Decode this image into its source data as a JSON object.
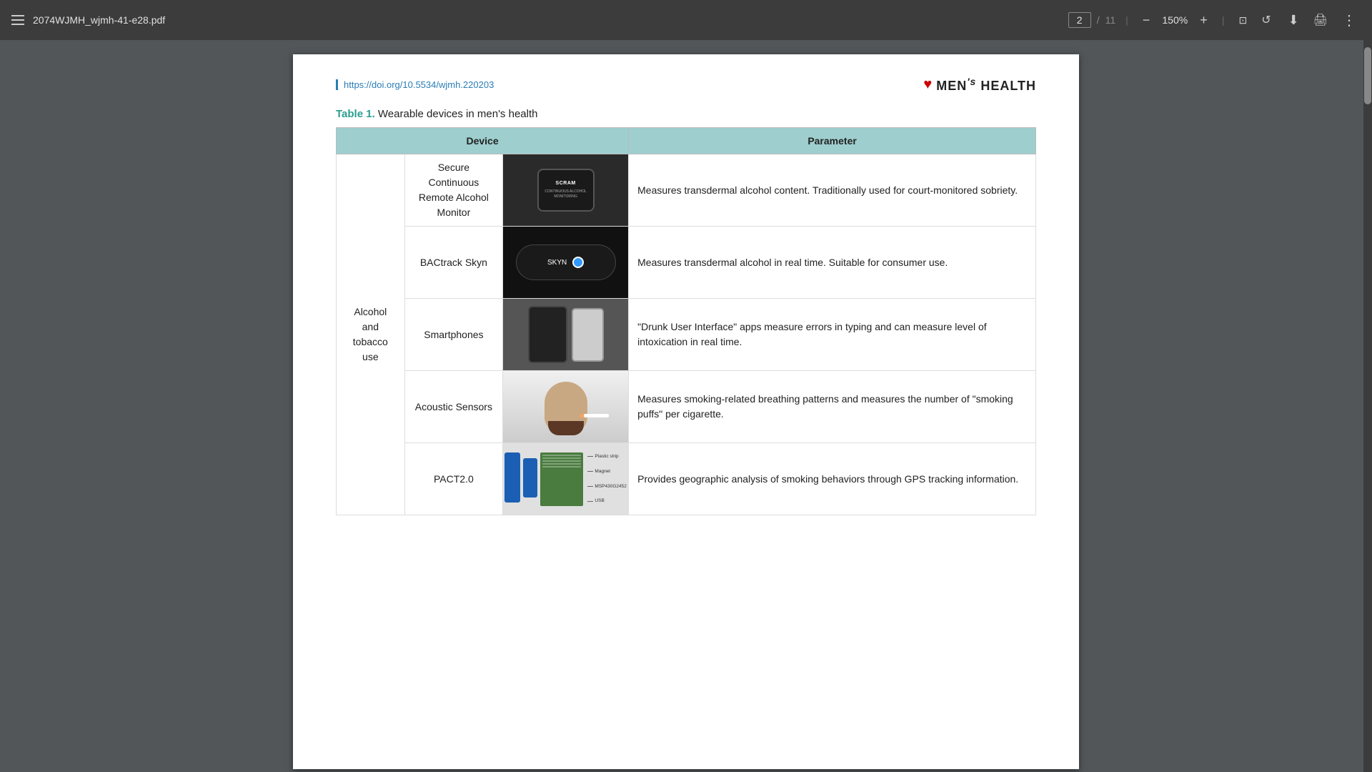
{
  "toolbar": {
    "filename": "2074WJMH_wjmh-41-e28.pdf",
    "hamburger_label": "menu",
    "current_page": "2",
    "total_pages": "11",
    "zoom": "150%",
    "download_label": "download",
    "print_label": "print",
    "more_label": "more",
    "zoom_in_label": "+",
    "zoom_out_label": "−",
    "fit_page_label": "fit page",
    "history_label": "history"
  },
  "page": {
    "doi": "https://doi.org/10.5534/wjmh.220203",
    "journal_name": "MEN's HEALTH",
    "table_label": "Table 1.",
    "table_title": "Wearable devices in men's health",
    "columns": {
      "device_header": "Device",
      "param_header": "Parameter"
    },
    "rows": [
      {
        "category": "Alcohol and tobacco use",
        "device_name": "Secure Continuous Remote Alcohol Monitor",
        "param": "Measures transdermal alcohol content. Traditionally used for court-monitored sobriety.",
        "image_type": "scram"
      },
      {
        "category": "",
        "device_name": "BACtrack Skyn",
        "param": "Measures transdermal alcohol in real time. Suitable for consumer use.",
        "image_type": "bactrack"
      },
      {
        "category": "",
        "device_name": "Smartphones",
        "param": "\"Drunk User Interface\" apps measure errors in typing and can measure level of intoxication in real time.",
        "image_type": "smartphones"
      },
      {
        "category": "",
        "device_name": "Acoustic Sensors",
        "param": "Measures smoking-related breathing patterns and measures the number of \"smoking puffs\" per cigarette.",
        "image_type": "acoustic"
      },
      {
        "category": "",
        "device_name": "PACT2.0",
        "param": "Provides geographic analysis of smoking behaviors through GPS tracking information.",
        "image_type": "pact",
        "pact_labels": [
          "Plastic strip",
          "Magnet",
          "MSP430G2452",
          "USB"
        ]
      }
    ]
  }
}
